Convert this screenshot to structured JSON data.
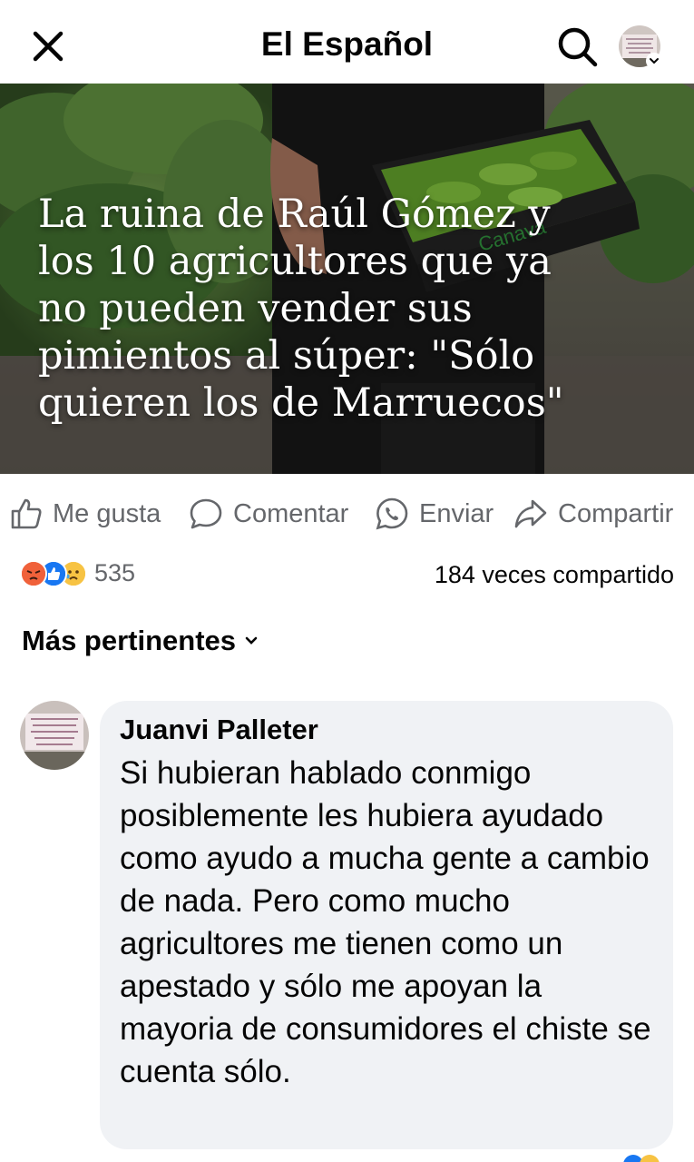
{
  "header": {
    "title": "El Español",
    "close_icon": "close-icon",
    "search_icon": "search-icon"
  },
  "post": {
    "image_headline": "La ruina de Raúl Gómez y los 10 agricultores que ya no pueden vender sus pimientos al súper: \"Sólo quieren los de Marruecos\"",
    "crate_brand": "Canava"
  },
  "actions": {
    "like": "Me gusta",
    "comment": "Comentar",
    "send": "Enviar",
    "share": "Compartir"
  },
  "stats": {
    "reaction_icons": [
      "angry",
      "like",
      "sad"
    ],
    "reaction_count": "535",
    "shares": "184 veces compartido"
  },
  "comments": {
    "sort_label": "Más pertinentes",
    "items": [
      {
        "author": "Juanvi Palleter",
        "text": "Si hubieran hablado conmigo posiblemente les hubiera ayudado como ayudo a mucha gente a cambio de nada. Pero como mucho agricultores me tienen como un apestado y sólo me apoyan la mayoria de consumidores el chiste se cuenta sólo."
      }
    ]
  },
  "colors": {
    "secondary_text": "#65676b",
    "bubble": "#f0f2f5",
    "like_blue": "#1877f2",
    "angry_red": "#e9710f"
  }
}
